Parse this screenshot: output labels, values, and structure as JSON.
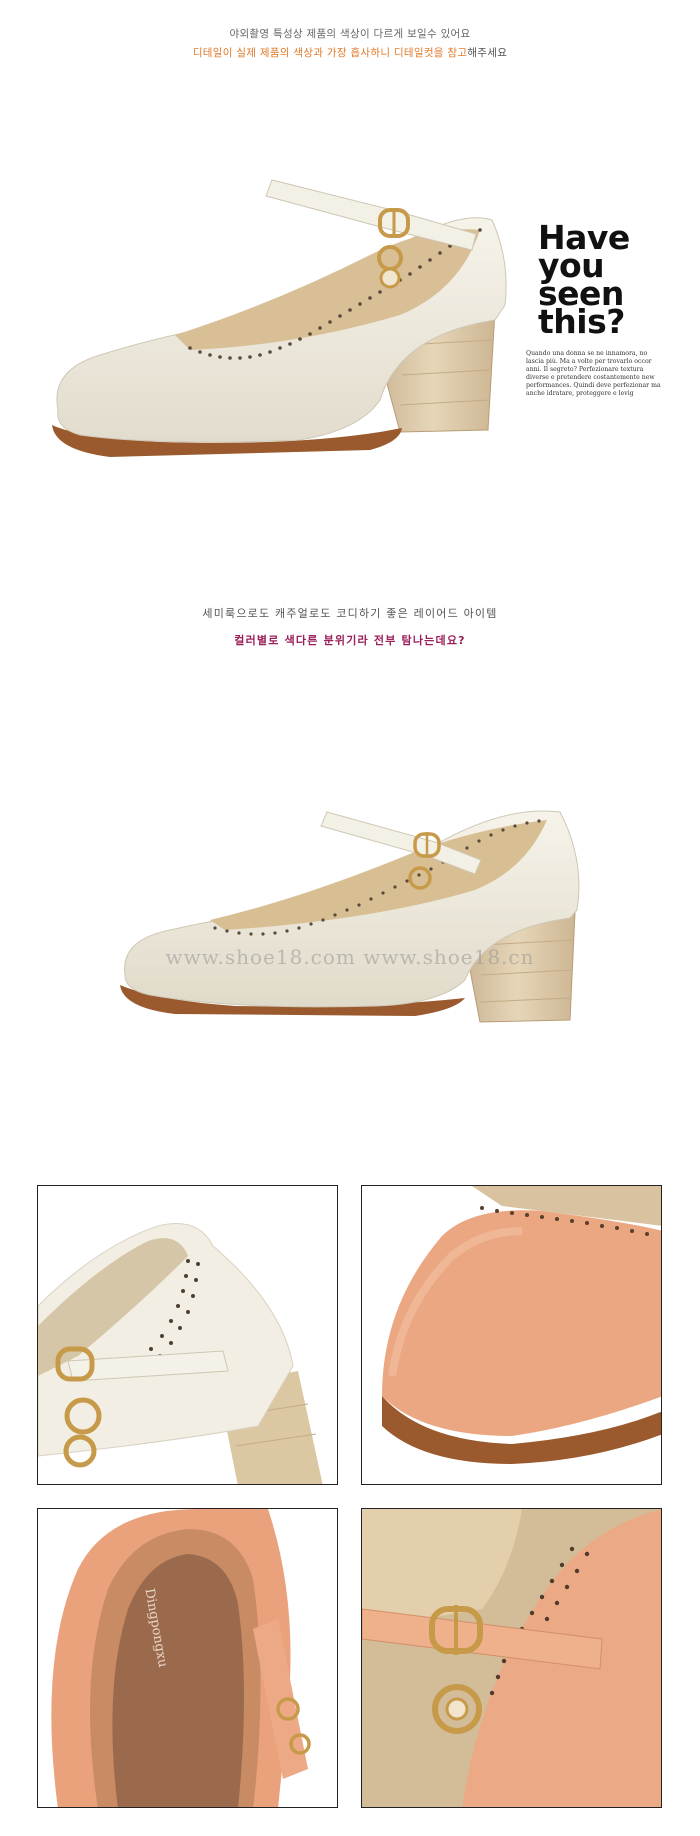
{
  "top_notice": {
    "line1": "야외촬영 특성상 제품의 색상이 다르게 보일수 있어요",
    "line2_highlight": "디테일이 실제 제품의 색상과 가장 흡사하니 디테일컷을 참고",
    "line2_rest": "해주세요"
  },
  "have_you_seen": {
    "title_lines": [
      "Have",
      "you",
      "seen",
      "this?"
    ],
    "small_text": "Quando una donna se ne innamora, no lascia più. Ma a volte per trovarlo occor anni. Il segreto? Perfezionare textura diverse e pretendere costantemente new performances. Quindi deve perfezionar ma anche idratare, proteggere e levig"
  },
  "mid_notice": {
    "line1": "세미룩으로도 캐주얼로도 코디하기 좋은 레이어드 아이템",
    "line2": "컬러별로 색다른 분위기라 전부 탐나는데요?"
  },
  "watermark": "www.shoe18.com  www.shoe18.cn",
  "insole_logo": "Dingpongxu",
  "colors": {
    "ivory": "#f1eee3",
    "ivory_shade": "#ddd7c7",
    "peach": "#ebab86",
    "peach_shade": "#d8906a",
    "sole": "#9a5a2d",
    "wood": "#d8c6a6",
    "gold": "#c79a4a",
    "accent_orange": "#e07a2a",
    "accent_plum": "#9a1f5a"
  },
  "detail_images": [
    {
      "name": "ivory-heel-closeup"
    },
    {
      "name": "peach-toe-closeup"
    },
    {
      "name": "peach-insole-closeup"
    },
    {
      "name": "peach-strap-buckle-closeup"
    }
  ]
}
